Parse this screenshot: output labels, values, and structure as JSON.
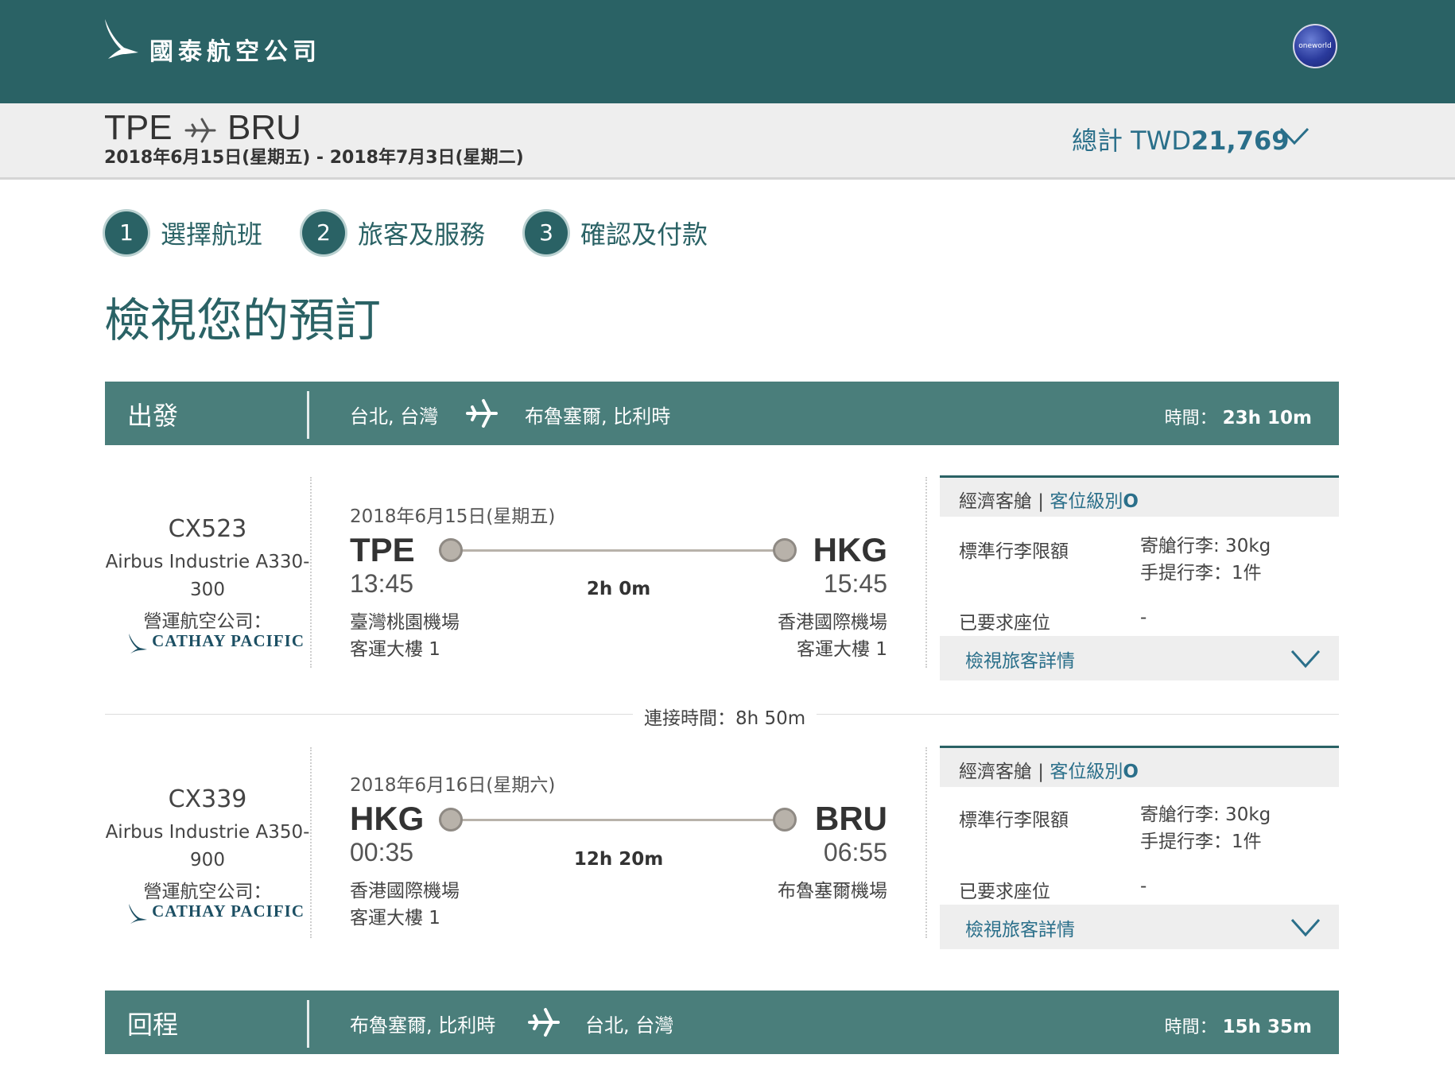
{
  "header": {
    "brand_name": "國泰航空公司",
    "alliance_logo_text": "oneworld"
  },
  "summary": {
    "origin": "TPE",
    "destination": "BRU",
    "dates": "2018年6月15日(星期五) - 2018年7月3日(星期二)",
    "total_prefix": "總計 TWD",
    "total_amount": "21,769"
  },
  "steps": [
    {
      "number": "1",
      "label": "選擇航班"
    },
    {
      "number": "2",
      "label": "旅客及服務"
    },
    {
      "number": "3",
      "label": "確認及付款"
    }
  ],
  "page_title": "檢視您的預訂",
  "outbound": {
    "label": "出發",
    "from": "台北, 台灣",
    "to": "布魯塞爾, 比利時",
    "duration_label": "時間：",
    "duration": "23h 10m"
  },
  "flights": [
    {
      "flight_no": "CX523",
      "aircraft_line1": "Airbus Industrie A330-",
      "aircraft_line2": "300",
      "operator_label": "營運航空公司：",
      "operator_name": "CATHAY PACIFIC",
      "date": "2018年6月15日(星期五)",
      "dep_code": "TPE",
      "dep_time": "13:45",
      "arr_code": "HKG",
      "arr_time": "15:45",
      "duration": "2h 0m",
      "dep_airport": "臺灣桃園機場",
      "dep_terminal": "客運大樓 1",
      "arr_airport": "香港國際機場",
      "arr_terminal": "客運大樓 1",
      "cabin": "經濟客艙",
      "separator": " | ",
      "fare_class_label": "客位級別",
      "fare_class": "O",
      "baggage_label": "標準行李限額",
      "checked_baggage": "寄艙行李: 30kg",
      "carry_on": "手提行李：1件",
      "seat_label": "已要求座位",
      "seat_value": "-",
      "details_link": "檢視旅客詳情"
    },
    {
      "flight_no": "CX339",
      "aircraft_line1": "Airbus Industrie A350-",
      "aircraft_line2": "900",
      "operator_label": "營運航空公司：",
      "operator_name": "CATHAY PACIFIC",
      "date": "2018年6月16日(星期六)",
      "dep_code": "HKG",
      "dep_time": "00:35",
      "arr_code": "BRU",
      "arr_time": "06:55",
      "duration": "12h 20m",
      "dep_airport": "香港國際機場",
      "dep_terminal": "客運大樓 1",
      "arr_airport": "布魯塞爾機場",
      "arr_terminal": "",
      "cabin": "經濟客艙",
      "separator": " | ",
      "fare_class_label": "客位級別",
      "fare_class": "O",
      "baggage_label": "標準行李限額",
      "checked_baggage": "寄艙行李: 30kg",
      "carry_on": "手提行李：1件",
      "seat_label": "已要求座位",
      "seat_value": "-",
      "details_link": "檢視旅客詳情"
    }
  ],
  "connection": {
    "text": "連接時間：8h 50m"
  },
  "return": {
    "label": "回程",
    "from": "布魯塞爾, 比利時",
    "to": "台北, 台灣",
    "duration_label": "時間：",
    "duration": "15h 35m"
  },
  "colors": {
    "brand_dark": "#2a6265",
    "bar": "#4a7e7b",
    "link": "#2a6f8a"
  }
}
